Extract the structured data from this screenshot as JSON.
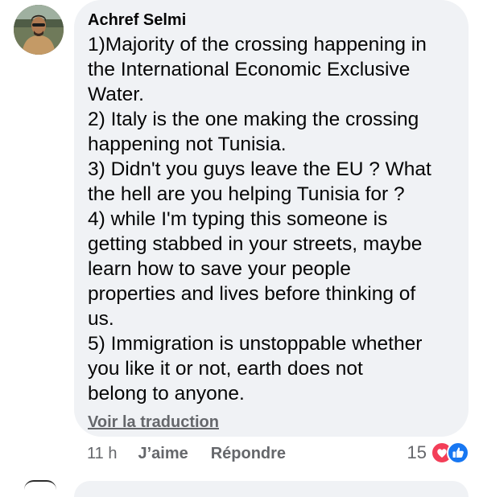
{
  "comment": {
    "author": "Achref Selmi",
    "lines": [
      "1)Majority of the crossing happening in",
      "the International Economic Exclusive",
      "Water.",
      "2) Italy is the one making the crossing",
      "happening not Tunisia.",
      "3) Didn't you guys leave the EU ? What",
      "the hell are you helping Tunisia for ?",
      "4) while I'm typing this someone is",
      "getting stabbed in your streets, maybe",
      "learn how to save your people",
      "properties and lives before thinking of",
      "us.",
      "5) Immigration is unstoppable whether",
      "you like it or not, earth does not",
      "belong to anyone."
    ],
    "translate_link": "Voir la traduction"
  },
  "actions": {
    "time": "11 h",
    "like_label": "J’aime",
    "reply_label": "Répondre"
  },
  "reactions": {
    "count": "15",
    "icons": [
      "love-reaction-icon",
      "like-reaction-icon"
    ]
  },
  "colors": {
    "bubble_bg": "#f0f2f5",
    "text": "#050505",
    "meta": "#65676b",
    "love": "#f33e58",
    "like": "#1877f2"
  }
}
